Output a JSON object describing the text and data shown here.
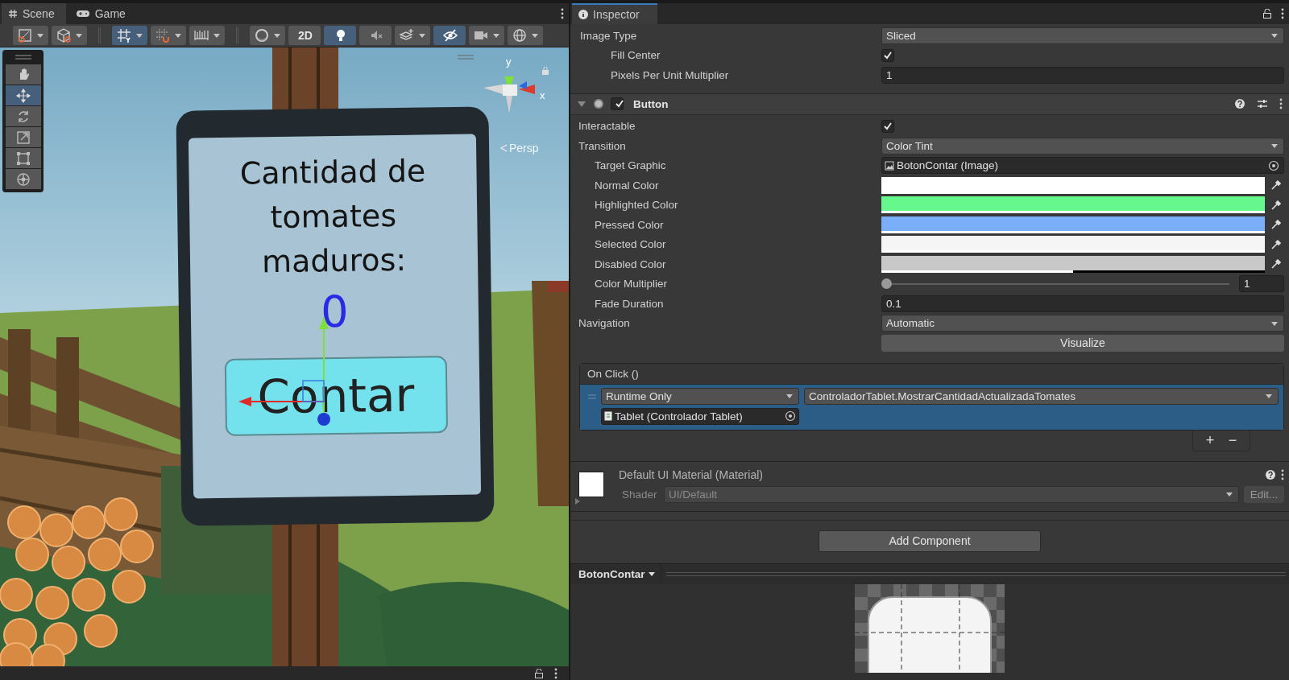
{
  "scene_window": {
    "tabs": [
      {
        "label": "Scene",
        "selected": true
      },
      {
        "label": "Game",
        "selected": false
      }
    ],
    "toolbar_groups": [
      [
        {
          "on": false,
          "dropdown": true
        },
        {
          "on": false,
          "dropdown": true
        }
      ],
      [
        {
          "on": true,
          "dropdown": true
        },
        {
          "on": false,
          "dropdown": true
        },
        {
          "on": false,
          "dropdown": true
        }
      ],
      [
        {
          "on": false,
          "dropdown": true
        },
        {
          "label": "2D",
          "on": false,
          "dropdown": false
        },
        {
          "on": true,
          "dropdown": false
        },
        {
          "on": false,
          "dropdown": false
        },
        {
          "on": false,
          "dropdown": true
        },
        {
          "on": true,
          "dropdown": false
        },
        {
          "on": false,
          "dropdown": true
        },
        {
          "on": false,
          "dropdown": true
        }
      ]
    ],
    "tools": [
      {
        "selected": false
      },
      {
        "selected": true
      },
      {
        "selected": false
      },
      {
        "selected": false
      },
      {
        "selected": false
      },
      {
        "selected": false
      }
    ],
    "orientation_gizmo": {
      "y_label": "y",
      "x_label": "x",
      "projection": "Persp"
    },
    "tablet": {
      "heading": "Cantidad de tomates maduros:",
      "count": "0",
      "button_label": "Contar"
    }
  },
  "inspector": {
    "title": "Inspector",
    "properties": [
      {
        "kind": "dropdown",
        "label": "Image Type",
        "value": "Sliced",
        "children": [
          {
            "kind": "checkbox",
            "label": "Fill Center",
            "checked": true
          },
          {
            "kind": "number",
            "label": "Pixels Per Unit Multiplier",
            "value": "1"
          }
        ]
      }
    ],
    "component": {
      "title": "Button",
      "enabled": true,
      "expanded": true,
      "properties": [
        {
          "kind": "checkbox",
          "label": "Interactable",
          "checked": true
        },
        {
          "kind": "dropdown",
          "label": "Transition",
          "value": "Color Tint",
          "children": [
            {
              "kind": "object",
              "label": "Target Graphic",
              "value": "BotonContar (Image)"
            },
            {
              "kind": "color",
              "label": "Normal Color",
              "color": "#ffffff",
              "level": 1
            },
            {
              "kind": "color",
              "label": "Highlighted Color",
              "color": "#66f78d",
              "level": 1
            },
            {
              "kind": "color",
              "label": "Pressed Color",
              "color": "#7aaef9",
              "level": 1
            },
            {
              "kind": "color",
              "label": "Selected Color",
              "color": "#f5f5f5",
              "level": 1
            },
            {
              "kind": "color",
              "label": "Disabled Color",
              "color": "#c8c8c8",
              "level": 0.5
            },
            {
              "kind": "slider",
              "label": "Color Multiplier",
              "level": 0,
              "value": "1"
            },
            {
              "kind": "number",
              "label": "Fade Duration",
              "value": "0.1"
            }
          ]
        },
        {
          "kind": "dropdown",
          "label": "Navigation",
          "value": "Automatic",
          "button": "Visualize"
        }
      ],
      "event": {
        "title": "On Click ()",
        "listeners": [
          {
            "mode": "Runtime Only",
            "function": "ControladorTablet.MostrarCantidadActualizadaTomates",
            "target": "Tablet (Controlador Tablet)",
            "selected": true
          }
        ],
        "add": "+",
        "remove": "−"
      }
    },
    "material": {
      "name": "Default UI Material (Material)",
      "expanded": false,
      "shader_label": "Shader",
      "shader": "UI/Default",
      "edit": "Edit..."
    },
    "add_component": "Add Component",
    "preview": {
      "title": "BotonContar"
    }
  }
}
